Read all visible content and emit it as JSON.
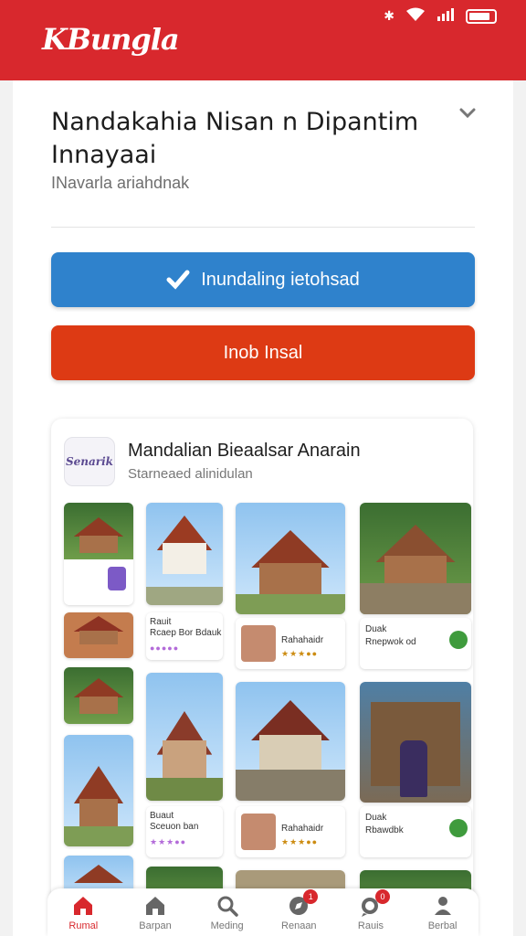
{
  "app": {
    "logo": "KBungla",
    "accent": "#d8282d"
  },
  "status": {
    "icons": [
      "bluetooth-icon",
      "wifi-icon",
      "signal-icon",
      "battery-icon"
    ]
  },
  "header": {
    "title": "Nandakahia Nisan n Dipantim Innayaai",
    "subtitle": "INavarla ariahdnak",
    "collapse_icon": "chevron-down-icon"
  },
  "actions": {
    "primary_label": "Inundaling ietohsad",
    "primary_icon": "check-icon",
    "primary_color": "#2f82cc",
    "secondary_label": "Inob Insal",
    "secondary_color": "#dd3a14"
  },
  "feature": {
    "app_icon_text": "Senarik",
    "title": "Mandalian Bieaalsar Anarain",
    "subtitle": "Starneaed alinidulan",
    "tiles": [
      {
        "caption": "Rauit",
        "line2": "Rcaep Bor Bdauk"
      },
      {
        "caption": "Rahahaidr"
      },
      {
        "caption": "Duak",
        "line2": "Rnepwok od"
      },
      {
        "caption": "Buaut",
        "line2": "Sceuon ban"
      },
      {
        "caption": "Rahahaidr"
      },
      {
        "caption": "Duak",
        "line2": "Rbawdbk"
      }
    ]
  },
  "nav": {
    "items": [
      {
        "label": "Rumal",
        "icon": "home-icon",
        "active": true
      },
      {
        "label": "Barpan",
        "icon": "house-icon"
      },
      {
        "label": "Meding",
        "icon": "search-icon"
      },
      {
        "label": "Renaan",
        "icon": "compass-icon",
        "badge": "1"
      },
      {
        "label": "Rauis",
        "icon": "chat-icon",
        "badge": "0"
      },
      {
        "label": "Berbal",
        "icon": "profile-icon"
      }
    ]
  }
}
